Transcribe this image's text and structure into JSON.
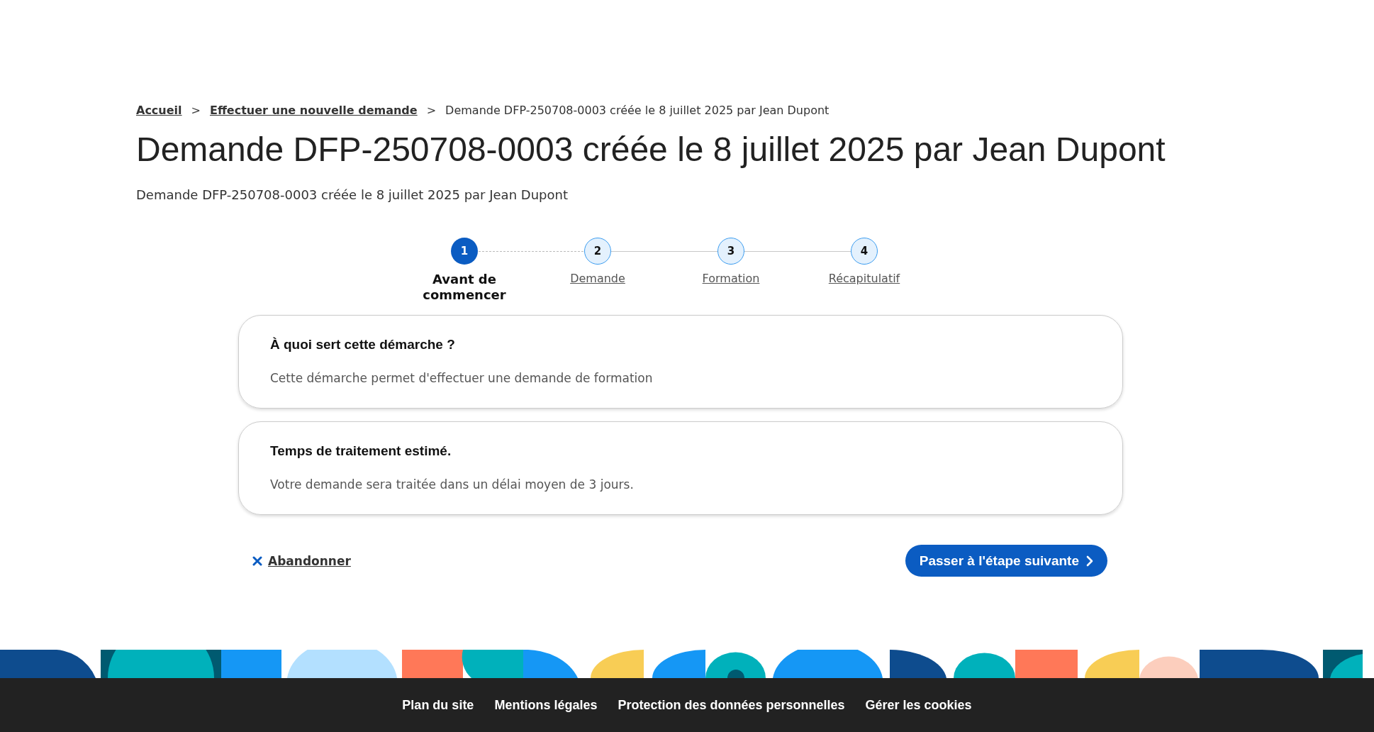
{
  "breadcrumb": [
    {
      "label": "Accueil",
      "link": true
    },
    {
      "separator": ">",
      "label": "Effectuer une nouvelle demande",
      "link": true
    },
    {
      "separator": ">",
      "label": "Demande DFP-250708-0003 créée le 8 juillet 2025 par Jean Dupont",
      "link": false
    }
  ],
  "title": "Demande DFP-250708-0003 créée le 8 juillet 2025 par Jean Dupont",
  "subtitle": "Demande DFP-250708-0003 créée le 8 juillet 2025 par Jean Dupont",
  "steps": [
    {
      "number": "1",
      "label": "Avant de commencer",
      "selected": true
    },
    {
      "number": "2",
      "label": "Demande",
      "selected": false
    },
    {
      "number": "3",
      "label": "Formation",
      "selected": false
    },
    {
      "number": "4",
      "label": "Récapitulatif",
      "selected": false
    }
  ],
  "cards": [
    {
      "title": "À quoi sert cette démarche ?",
      "text": "Cette démarche permet d'effectuer une demande de formation"
    },
    {
      "title": "Temps de traitement estimé.",
      "text": "Votre demande sera traitée dans un délai moyen de 3 jours."
    }
  ],
  "cancel_link": "Abandonner",
  "next_button": "Passer à l'étape suivante",
  "footer_links": [
    "Plan du site",
    "Mentions légales",
    "Protection des données personnelles",
    "Gérer les cookies"
  ]
}
